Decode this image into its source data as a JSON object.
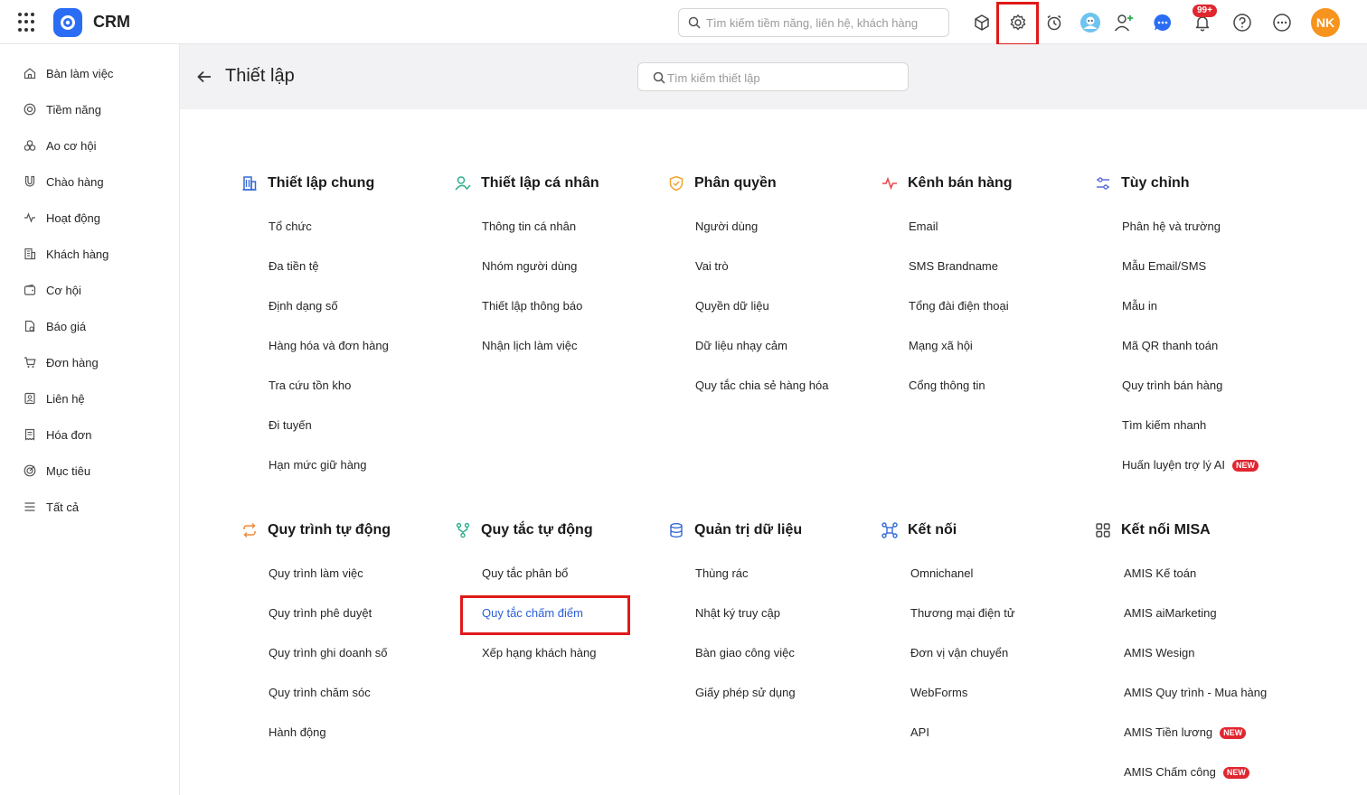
{
  "app": {
    "title": "CRM"
  },
  "search": {
    "placeholder": "Tìm kiếm tiềm năng, liên hệ, khách hàng"
  },
  "notifications": {
    "count": "99+"
  },
  "user": {
    "initials": "NK"
  },
  "colors": {
    "accent": "#2a6df4",
    "highlight": "#e01919",
    "badge": "#e0262f",
    "avatar": "#f7941d",
    "link_active": "#2b5fd9"
  },
  "sidebar": {
    "items": [
      {
        "label": "Bàn làm việc",
        "icon": "home-icon"
      },
      {
        "label": "Tiềm năng",
        "icon": "target-icon"
      },
      {
        "label": "Ao cơ hội",
        "icon": "pool-icon"
      },
      {
        "label": "Chào hàng",
        "icon": "magnet-icon"
      },
      {
        "label": "Hoạt động",
        "icon": "activity-icon"
      },
      {
        "label": "Khách hàng",
        "icon": "building-icon"
      },
      {
        "label": "Cơ hội",
        "icon": "wallet-icon"
      },
      {
        "label": "Báo giá",
        "icon": "quote-icon"
      },
      {
        "label": "Đơn hàng",
        "icon": "cart-icon"
      },
      {
        "label": "Liên hệ",
        "icon": "contact-icon"
      },
      {
        "label": "Hóa đơn",
        "icon": "invoice-icon"
      },
      {
        "label": "Mục tiêu",
        "icon": "goal-icon"
      },
      {
        "label": "Tất cả",
        "icon": "menu-icon"
      }
    ]
  },
  "header": {
    "title": "Thiết lập",
    "search_placeholder": "Tìm kiếm thiết lập"
  },
  "new_label": "NEW",
  "sections": [
    {
      "title": "Thiết lập chung",
      "icon": "building-icon",
      "items": [
        "Tổ chức",
        "Đa tiền tệ",
        "Định dạng số",
        "Hàng hóa và đơn hàng",
        "Tra cứu tồn kho",
        "Đi tuyến",
        "Hạn mức giữ hàng"
      ]
    },
    {
      "title": "Thiết lập cá nhân",
      "icon": "user-check-icon",
      "items": [
        "Thông tin cá nhân",
        "Nhóm người dùng",
        "Thiết lập thông báo",
        "Nhận lịch làm việc"
      ]
    },
    {
      "title": "Phân quyền",
      "icon": "shield-icon",
      "items": [
        "Người dùng",
        "Vai trò",
        "Quyền dữ liệu",
        "Dữ liệu nhạy cảm",
        "Quy tắc chia sẻ hàng hóa"
      ]
    },
    {
      "title": "Kênh bán hàng",
      "icon": "pulse-icon",
      "items": [
        "Email",
        "SMS Brandname",
        "Tổng đài điện thoại",
        "Mạng xã hội",
        "Cổng thông tin"
      ]
    },
    {
      "title": "Tùy chỉnh",
      "icon": "sliders-icon",
      "items": [
        "Phân hệ và trường",
        "Mẫu Email/SMS",
        "Mẫu in",
        "Mã QR thanh toán",
        "Quy trình bán hàng",
        "Tìm kiếm nhanh",
        "Huấn luyện trợ lý AI"
      ]
    },
    {
      "title": "Quy trình tự động",
      "icon": "repeat-icon",
      "items": [
        "Quy trình làm việc",
        "Quy trình phê duyệt",
        "Quy trình ghi doanh số",
        "Quy trình chăm sóc",
        "Hành động"
      ]
    },
    {
      "title": "Quy tắc tự động",
      "icon": "flow-icon",
      "items": [
        "Quy tắc phân bổ",
        "Quy tắc chấm điểm",
        "Xếp hạng khách hàng"
      ]
    },
    {
      "title": "Quản trị dữ liệu",
      "icon": "database-icon",
      "items": [
        "Thùng rác",
        "Nhật ký truy cập",
        "Bàn giao công việc",
        "Giấy phép sử dụng"
      ]
    },
    {
      "title": "Kết nối",
      "icon": "connect-icon",
      "items": [
        "Omnichanel",
        "Thương mại điện tử",
        "Đơn vị vận chuyển",
        "WebForms",
        "API"
      ]
    },
    {
      "title": "Kết nối MISA",
      "icon": "apps-icon",
      "items": [
        "AMIS Kế toán",
        "AMIS aiMarketing",
        "AMIS Wesign",
        "AMIS Quy trình - Mua hàng",
        "AMIS Tiền lương",
        "AMIS Chấm công"
      ]
    }
  ]
}
